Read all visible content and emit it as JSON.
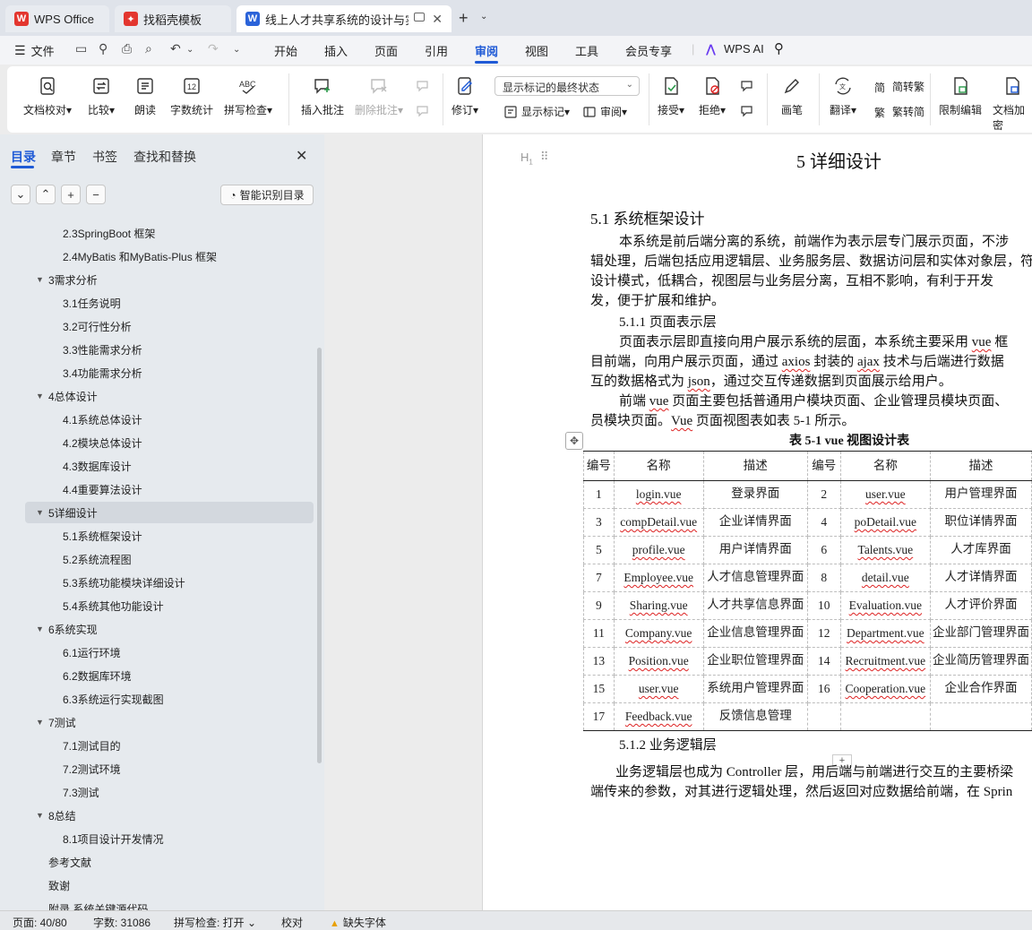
{
  "tabs": [
    {
      "label": "WPS Office",
      "icon": "wps-logo-icon"
    },
    {
      "label": "找稻壳模板",
      "icon": "docer-logo-icon"
    },
    {
      "label": "线上人才共享系统的设计与实现",
      "icon": "writer-doc-icon"
    }
  ],
  "menubar": {
    "file": "文件",
    "items": [
      "开始",
      "插入",
      "页面",
      "引用",
      "审阅",
      "视图",
      "工具",
      "会员专享"
    ],
    "active": "审阅",
    "wps_ai": "WPS AI"
  },
  "ribbon": {
    "doc_check": "文档校对",
    "compare": "比较",
    "read_aloud": "朗读",
    "word_count": "字数统计",
    "spell_check": "拼写检查",
    "insert_comment": "插入批注",
    "delete_comment": "删除批注",
    "revise": "修订",
    "markup_select": "显示标记的最终状态",
    "show_markup": "显示标记",
    "review": "审阅",
    "accept": "接受",
    "reject": "拒绝",
    "pen": "画笔",
    "translate": "翻译",
    "to_traditional": "简转繁",
    "to_simplified": "繁转简",
    "restrict_edit": "限制编辑",
    "doc_encrypt": "文档加密"
  },
  "nav": {
    "tabs": [
      "目录",
      "章节",
      "书签",
      "查找和替换"
    ],
    "smart_toc": "智能识别目录",
    "toc": [
      {
        "label": "2.3SpringBoot 框架",
        "level": 2
      },
      {
        "label": "2.4MyBatis 和MyBatis-Plus 框架",
        "level": 2
      },
      {
        "label": "3需求分析",
        "level": 1,
        "expanded": true
      },
      {
        "label": "3.1任务说明",
        "level": 2
      },
      {
        "label": "3.2可行性分析",
        "level": 2
      },
      {
        "label": "3.3性能需求分析",
        "level": 2
      },
      {
        "label": "3.4功能需求分析",
        "level": 2
      },
      {
        "label": "4总体设计",
        "level": 1,
        "expanded": true
      },
      {
        "label": "4.1系统总体设计",
        "level": 2
      },
      {
        "label": "4.2模块总体设计",
        "level": 2
      },
      {
        "label": "4.3数据库设计",
        "level": 2
      },
      {
        "label": "4.4重要算法设计",
        "level": 2
      },
      {
        "label": "5详细设计",
        "level": 1,
        "expanded": true,
        "selected": true
      },
      {
        "label": "5.1系统框架设计",
        "level": 2
      },
      {
        "label": "5.2系统流程图",
        "level": 2
      },
      {
        "label": "5.3系统功能模块详细设计",
        "level": 2
      },
      {
        "label": "5.4系统其他功能设计",
        "level": 2
      },
      {
        "label": "6系统实现",
        "level": 1,
        "expanded": true
      },
      {
        "label": "6.1运行环境",
        "level": 2
      },
      {
        "label": "6.2数据库环境",
        "level": 2
      },
      {
        "label": "6.3系统运行实现截图",
        "level": 2
      },
      {
        "label": "7测试",
        "level": 1,
        "expanded": true
      },
      {
        "label": "7.1测试目的",
        "level": 2
      },
      {
        "label": "7.2测试环境",
        "level": 2
      },
      {
        "label": "7.3测试",
        "level": 2
      },
      {
        "label": "8总结",
        "level": 1,
        "expanded": true
      },
      {
        "label": "8.1项目设计开发情况",
        "level": 2
      },
      {
        "label": "参考文献",
        "level": 1
      },
      {
        "label": "致谢",
        "level": 1
      },
      {
        "label": "附录 系统关键源代码",
        "level": 1
      }
    ]
  },
  "doc": {
    "heading_tag": "H",
    "chapter_title": "5  详细设计",
    "section_title": "5.1  系统框架设计",
    "p1": [
      "本系统是前后端分离的系统，前端作为表示层专门展示页面，不涉",
      "辑处理，后端包括应用逻辑层、业务服务层、数据访问层和实体对象层，符",
      "设计模式，低耦合，视图层与业务层分离，互相不影响，有利于开发",
      "发，便于扩展和维护。"
    ],
    "sub1": "5.1.1  页面表示层",
    "p2": [
      {
        "pre": "页面表示层即直接向用户展示系统的层面，本系统主要采用 ",
        "w": "vue",
        "post": " 框"
      },
      {
        "pre": "目前端，向用户展示页面，通过 ",
        "w": "axios",
        "mid": " 封装的 ",
        "w2": "ajax",
        "post": " 技术与后端进行数据"
      },
      {
        "pre": "互的数据格式为 ",
        "w": "json",
        "post": "，通过交互传递数据到页面展示给用户。"
      }
    ],
    "p3": [
      {
        "pre": "前端 ",
        "w": "vue",
        "post": " 页面主要包括普通用户模块页面、企业管理员模块页面、"
      },
      {
        "pre": "员模块页面。",
        "w": "Vue",
        "post": " 页面视图表如表 5-1 所示。"
      }
    ],
    "table_caption": "表 5-1   vue 视图设计表",
    "table": {
      "headers": [
        "编号",
        "名称",
        "描述",
        "编号",
        "名称",
        "描述"
      ],
      "rows": [
        [
          "1",
          "login.vue",
          "登录界面",
          "2",
          "user.vue",
          "用户管理界面"
        ],
        [
          "3",
          "compDetail.vue",
          "企业详情界面",
          "4",
          "poDetail.vue",
          "职位详情界面"
        ],
        [
          "5",
          "profile.vue",
          "用户详情界面",
          "6",
          "Talents.vue",
          "人才库界面"
        ],
        [
          "7",
          "Employee.vue",
          "人才信息管理界面",
          "8",
          "detail.vue",
          "人才详情界面"
        ],
        [
          "9",
          "Sharing.vue",
          "人才共享信息界面",
          "10",
          "Evaluation.vue",
          "人才评价界面"
        ],
        [
          "11",
          "Company.vue",
          "企业信息管理界面",
          "12",
          "Department.vue",
          "企业部门管理界面"
        ],
        [
          "13",
          "Position.vue",
          "企业职位管理界面",
          "14",
          "Recruitment.vue",
          "企业简历管理界面"
        ],
        [
          "15",
          "user.vue",
          "系统用户管理界面",
          "16",
          "Cooperation.vue",
          "企业合作界面"
        ],
        [
          "17",
          "Feedback.vue",
          "反馈信息管理",
          "",
          "",
          ""
        ]
      ]
    },
    "sub2": "5.1.2  业务逻辑层",
    "p4": [
      "业务逻辑层也成为 Controller 层，用后端与前端进行交互的主要桥梁",
      "端传来的参数，对其进行逻辑处理，然后返回对应数据给前端，在 Sprin"
    ]
  },
  "status": {
    "page": "页面: 40/80",
    "words": "字数: 31086",
    "spell": "拼写检查: 打开",
    "proof": "校对",
    "missing_font": "缺失字体"
  },
  "colors": {
    "accent": "#1f5ad6",
    "wps_red": "#e3362f",
    "warn": "#e8a000"
  }
}
